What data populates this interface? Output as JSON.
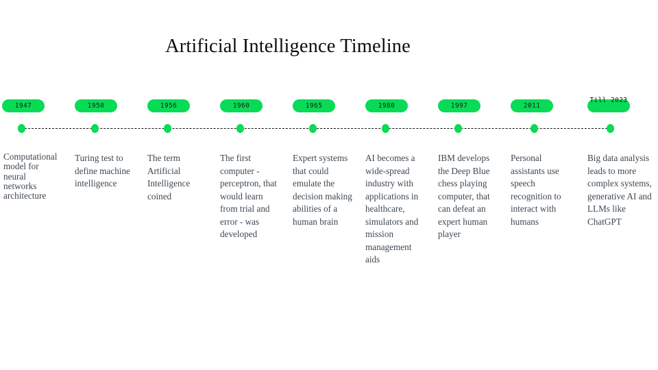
{
  "page": {
    "title": "Artificial Intelligence Timeline",
    "accent_color": "#09db56",
    "text_color": "#3d4852",
    "title_color": "#0d0d0d",
    "background_color": "#ffffff",
    "baseline_style": "dashed"
  },
  "timeline": {
    "milestones": [
      {
        "label": "1947",
        "description": "Computational model for neural networks architecture"
      },
      {
        "label": "1950",
        "description": "Turing test to define machine intelligence"
      },
      {
        "label": "1956",
        "description": "The term Artificial Intelligence coined"
      },
      {
        "label": "1960",
        "description": "The first computer - perceptron, that would learn from trial and error - was developed"
      },
      {
        "label": "1965",
        "description": "Expert systems that could emulate the decision making abilities of a human brain"
      },
      {
        "label": "1980",
        "description": "AI becomes a wide-spread industry with applications in healthcare, simulators and mission management aids"
      },
      {
        "label": "1997",
        "description": "IBM develops the Deep Blue chess playing computer, that can defeat an expert human player"
      },
      {
        "label": "2011",
        "description": "Personal assistants use speech recognition to interact with humans"
      },
      {
        "label": "Till 2023",
        "description": "Big data analysis leads to more complex systems, generative AI and LLMs like ChatGPT"
      }
    ]
  }
}
